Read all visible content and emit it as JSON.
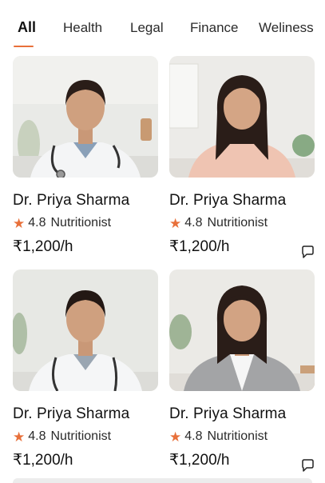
{
  "tabs": [
    {
      "label": "All",
      "active": true
    },
    {
      "label": "Health",
      "active": false
    },
    {
      "label": "Legal",
      "active": false
    },
    {
      "label": "Finance",
      "active": false
    },
    {
      "label": "Weliness",
      "active": false
    }
  ],
  "colors": {
    "accent": "#e8703a",
    "text": "#111111"
  },
  "experts": [
    {
      "name": "Dr. Priya Sharma",
      "rating": "4.8",
      "specialty": "Nutritionist",
      "price": "₹1,200/h",
      "outfit": "doctor-coat",
      "has_chat": false
    },
    {
      "name": "Dr. Priya Sharma",
      "rating": "4.8",
      "specialty": "Nutritionist",
      "price": "₹1,200/h",
      "outfit": "pink-blouse",
      "has_chat": true
    },
    {
      "name": "Dr. Priya Sharma",
      "rating": "4.8",
      "specialty": "Nutritionist",
      "price": "₹1,200/h",
      "outfit": "doctor-coat",
      "has_chat": false
    },
    {
      "name": "Dr. Priya Sharma",
      "rating": "4.8",
      "specialty": "Nutritionist",
      "price": "₹1,200/h",
      "outfit": "grey-blazer",
      "has_chat": true
    }
  ],
  "icons": {
    "rating": "star-icon",
    "chat": "chat-bubble-icon"
  }
}
